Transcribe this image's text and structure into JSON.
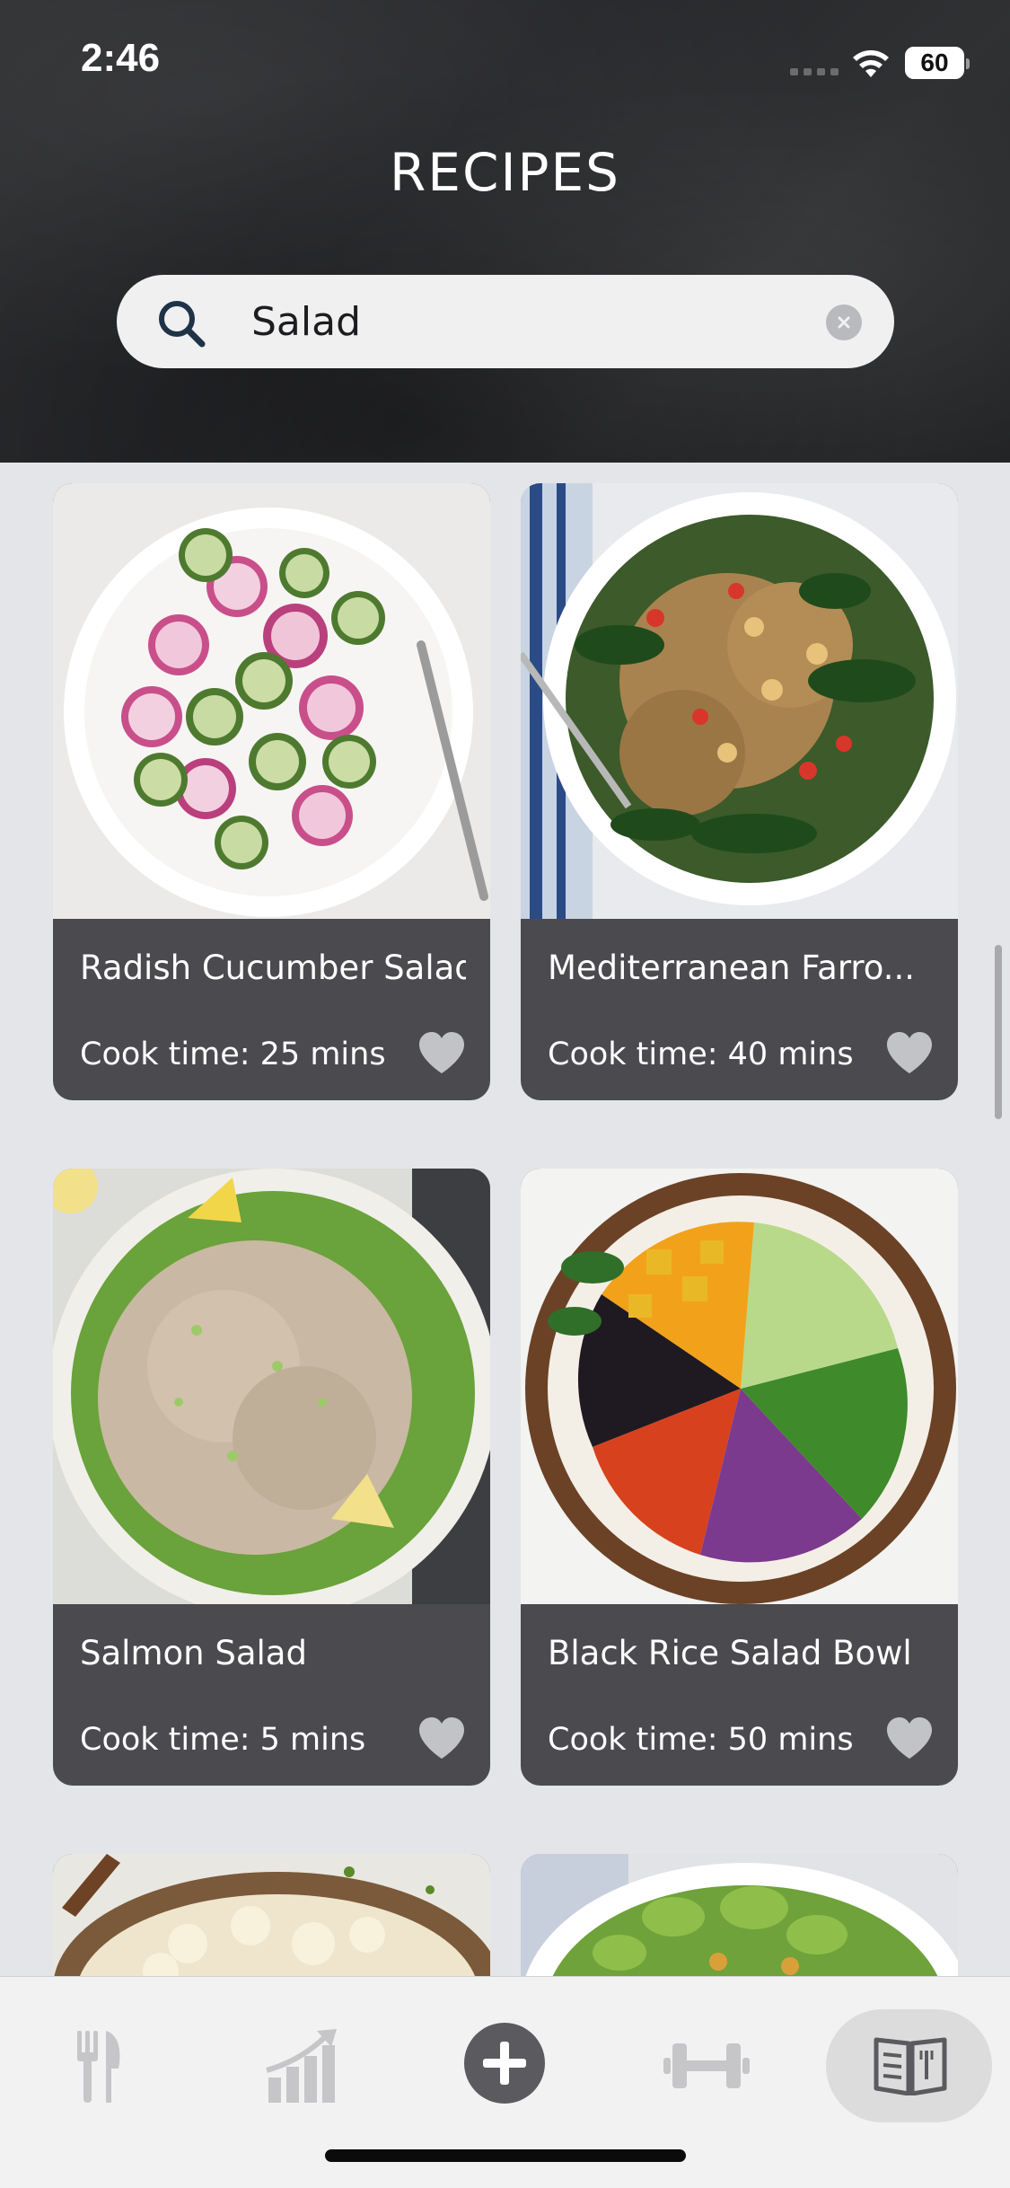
{
  "status_bar": {
    "time": "2:46",
    "battery": "60"
  },
  "header": {
    "title": "RECIPES"
  },
  "search": {
    "value": "Salad"
  },
  "recipes": [
    {
      "title": "Radish Cucumber Salad",
      "cook_time": "Cook time: 25 mins"
    },
    {
      "title": "Mediterranean Farro...",
      "cook_time": "Cook time: 40 mins"
    },
    {
      "title": "Salmon Salad",
      "cook_time": "Cook time: 5 mins"
    },
    {
      "title": "Black Rice Salad Bowl",
      "cook_time": "Cook time: 50 mins"
    }
  ],
  "tabbar": {
    "items": [
      "fork-knife-icon",
      "chart-growth-icon",
      "plus-circle-icon",
      "dumbbell-icon",
      "recipe-book-icon"
    ],
    "active": "recipe-book-icon"
  },
  "colors": {
    "card_footer": "#4a4a4f",
    "heart": "#c2c3c7",
    "tab_inactive": "#c6c6c8",
    "tab_active": "#5b5b5f"
  }
}
